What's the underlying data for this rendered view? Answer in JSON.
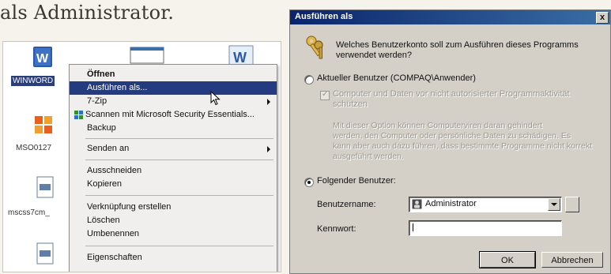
{
  "page": {
    "heading": "als Administrator."
  },
  "desktop": {
    "icons": [
      {
        "label": "WINWORD",
        "icon": "word-icon"
      },
      {
        "label": "MSO0127",
        "icon": "office-icon"
      },
      {
        "label": "mscss7cm_",
        "icon": "document-icon"
      },
      {
        "label": "",
        "icon": "document-icon"
      },
      {
        "label": "",
        "icon": "window-icon"
      },
      {
        "label": "",
        "icon": "word-icon"
      }
    ]
  },
  "context_menu": {
    "items": [
      {
        "label": "Öffnen",
        "bold": true
      },
      {
        "label": "Ausführen als...",
        "highlighted": true
      },
      {
        "label": "7-Zip",
        "submenu": true
      },
      {
        "label": "Scannen mit Microsoft Security Essentials...",
        "icon": "security-essentials-icon"
      },
      {
        "label": "Backup"
      },
      {
        "label": "Senden an",
        "submenu": true
      },
      {
        "label": "Ausschneiden"
      },
      {
        "label": "Kopieren"
      },
      {
        "label": "Verknüpfung erstellen"
      },
      {
        "label": "Löschen"
      },
      {
        "label": "Umbenennen"
      },
      {
        "label": "Eigenschaften"
      }
    ]
  },
  "dialog": {
    "title": "Ausführen als",
    "close_label": "x",
    "prompt": "Welches Benutzerkonto soll zum Ausführen dieses Programms verwendet werden?",
    "prompt_line1": "Welches Benutzerkonto soll zum Ausführen dieses Programms",
    "prompt_line2": "verwendet werden?",
    "option_current_user": "Aktueller Benutzer (COMPAQ\\Anwender)",
    "checkbox_text_line1": "Computer und Daten vor nicht autorisierter Programmaktivität",
    "checkbox_text_line2": "schützen",
    "disabled_note_line1": "Mit dieser Option können Computerviren daran gehindert",
    "disabled_note_line2": "werden, den Computer oder persönliche Daten zu schädigen. Es",
    "disabled_note_line3": "kann aber auch dazu führen, dass bestimmte Programme nicht korrekt",
    "disabled_note_line4": "ausgeführt werden.",
    "option_following_user": "Folgender Benutzer:",
    "username_label": "Benutzername:",
    "username_value": "Administrator",
    "password_label": "Kennwort:",
    "password_value": "",
    "ok_label": "OK",
    "cancel_label": "Abbrechen",
    "selected_option": "following_user"
  },
  "colors": {
    "menu_highlight": "#253b80",
    "titlebar_start": "#0a246a",
    "titlebar_end": "#3a6ea5",
    "dialog_face": "#d4d0c8"
  }
}
